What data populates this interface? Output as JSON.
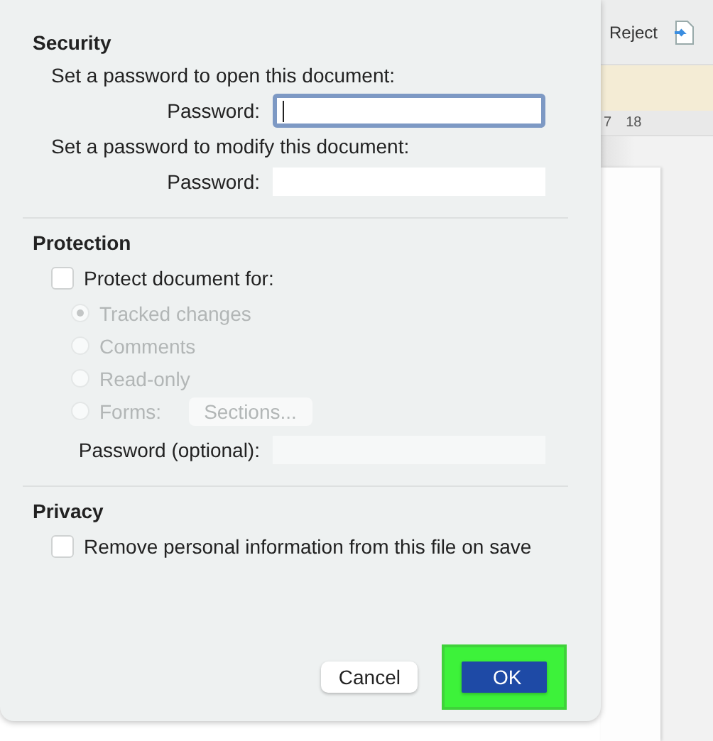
{
  "background": {
    "toolbar_button": "Reject",
    "ruler_labels": [
      "7",
      "18"
    ]
  },
  "security": {
    "heading": "Security",
    "fields": [
      {
        "prompt": "Set a password to open this document:",
        "label": "Password:",
        "focused": true
      },
      {
        "prompt": "Set a password to modify this document:",
        "label": "Password:",
        "focused": false
      }
    ]
  },
  "protection": {
    "heading": "Protection",
    "checkbox": {
      "label": "Protect document for:",
      "checked": false
    },
    "options": [
      {
        "label": "Tracked changes",
        "selected": true,
        "disabled": true
      },
      {
        "label": "Comments",
        "selected": false,
        "disabled": true
      },
      {
        "label": "Read-only",
        "selected": false,
        "disabled": true
      },
      {
        "label": "Forms:",
        "selected": false,
        "disabled": true,
        "button": "Sections..."
      }
    ],
    "password_label": "Password (optional):"
  },
  "privacy": {
    "heading": "Privacy",
    "checkbox": {
      "label": "Remove personal information from this file on save",
      "checked": false
    }
  },
  "buttons": [
    {
      "label": "Cancel",
      "kind": "secondary",
      "highlighted": false
    },
    {
      "label": "OK",
      "kind": "primary",
      "highlighted": true
    }
  ]
}
